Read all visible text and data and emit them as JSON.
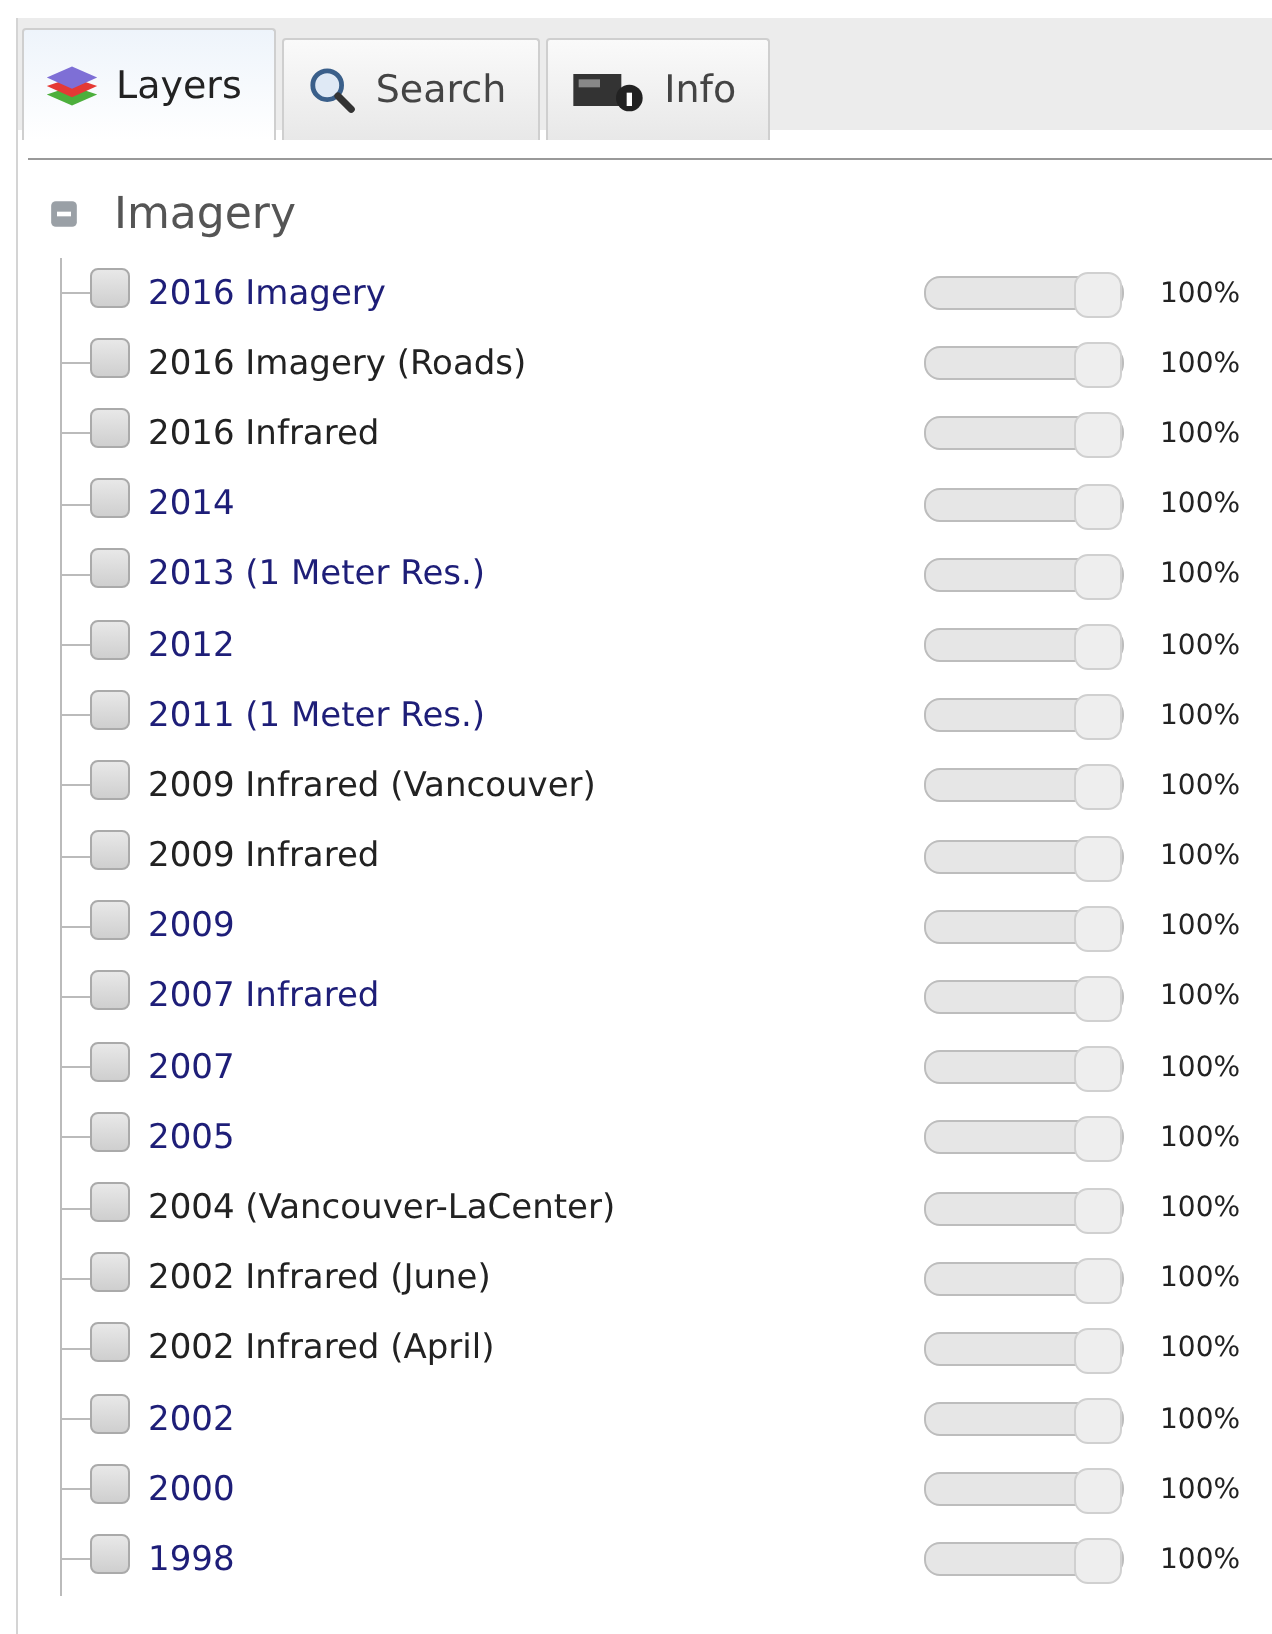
{
  "tabs": [
    {
      "label": "Layers",
      "kind": "layers",
      "selected": true
    },
    {
      "label": "Search",
      "kind": "search",
      "selected": false
    },
    {
      "label": "Info",
      "kind": "info",
      "selected": false
    }
  ],
  "group": {
    "title": "Imagery",
    "expanded": true,
    "layers": [
      {
        "label": "2016 Imagery",
        "color": "#1e1e78",
        "checked": false,
        "level": 1,
        "reading": "100%"
      },
      {
        "label": "2016 Imagery (Roads)",
        "color": "#222222",
        "checked": false,
        "level": 1,
        "reading": "100%"
      },
      {
        "label": "2016 Infrared",
        "color": "#222222",
        "checked": false,
        "level": 1,
        "reading": "100%"
      },
      {
        "label": "2014",
        "color": "#1e1e78",
        "checked": false,
        "level": 1,
        "reading": "100%"
      },
      {
        "label": "2013 (1 Meter Res.)",
        "color": "#1e1e78",
        "checked": false,
        "level": 1,
        "reading": "100%"
      },
      {
        "label": "2012",
        "color": "#1e1e78",
        "checked": false,
        "level": 1,
        "reading": "100%"
      },
      {
        "label": "2011 (1 Meter Res.)",
        "color": "#1e1e78",
        "checked": false,
        "level": 1,
        "reading": "100%"
      },
      {
        "label": "2009 Infrared (Vancouver)",
        "color": "#222222",
        "checked": false,
        "level": 1,
        "reading": "100%"
      },
      {
        "label": "2009 Infrared",
        "color": "#222222",
        "checked": false,
        "level": 1,
        "reading": "100%"
      },
      {
        "label": "2009",
        "color": "#1e1e78",
        "checked": false,
        "level": 1,
        "reading": "100%"
      },
      {
        "label": "2007 Infrared",
        "color": "#1e1e78",
        "checked": false,
        "level": 1,
        "reading": "100%"
      },
      {
        "label": "2007",
        "color": "#1e1e78",
        "checked": false,
        "level": 1,
        "reading": "100%"
      },
      {
        "label": "2005",
        "color": "#1e1e78",
        "checked": false,
        "level": 1,
        "reading": "100%"
      },
      {
        "label": "2004 (Vancouver-LaCenter)",
        "color": "#222222",
        "checked": false,
        "level": 1,
        "reading": "100%"
      },
      {
        "label": "2002 Infrared (June)",
        "color": "#222222",
        "checked": false,
        "level": 1,
        "reading": "100%"
      },
      {
        "label": "2002 Infrared (April)",
        "color": "#222222",
        "checked": false,
        "level": 1,
        "reading": "100%"
      },
      {
        "label": "2002",
        "color": "#1e1e78",
        "checked": false,
        "level": 1,
        "reading": "100%"
      },
      {
        "label": "2000",
        "color": "#1e1e78",
        "checked": false,
        "level": 1,
        "reading": "100%"
      },
      {
        "label": "1998",
        "color": "#1e1e78",
        "checked": false,
        "level": 1,
        "reading": "100%"
      }
    ]
  }
}
